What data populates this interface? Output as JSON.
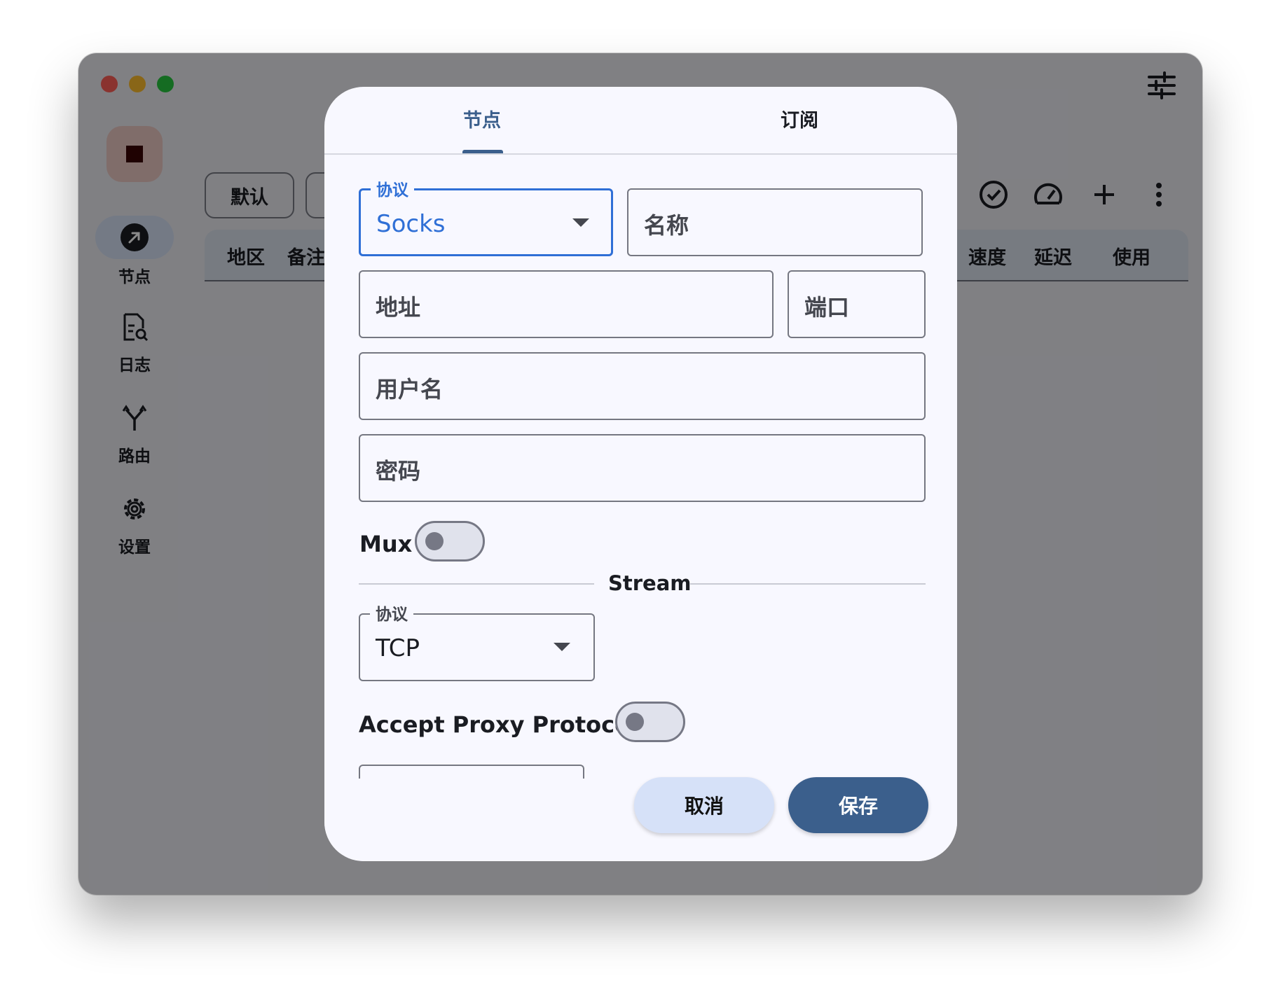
{
  "nav": {
    "items": [
      {
        "label": "节点"
      },
      {
        "label": "日志"
      },
      {
        "label": "路由"
      },
      {
        "label": "设置"
      }
    ]
  },
  "chips": {
    "default": "默认"
  },
  "table": {
    "headers": {
      "region": "地区",
      "note": "备注",
      "speed": "速度",
      "latency": "延迟",
      "usage": "使用"
    }
  },
  "dialog": {
    "tabs": {
      "node": "节点",
      "subscription": "订阅"
    },
    "protocol": {
      "label": "协议",
      "value": "Socks"
    },
    "fields": {
      "name": "名称",
      "address": "地址",
      "port": "端口",
      "username": "用户名",
      "password": "密码"
    },
    "mux_label": "Mux",
    "stream_label": "Stream",
    "stream_protocol": {
      "label": "协议",
      "value": "TCP"
    },
    "accept_proxy_label": "Accept Proxy Protocol",
    "cancel": "取消",
    "save": "保存"
  },
  "colors": {
    "accent": "#3b5f8c",
    "focus": "#2f6fd6",
    "cancel_bg": "#d6e1f8"
  }
}
